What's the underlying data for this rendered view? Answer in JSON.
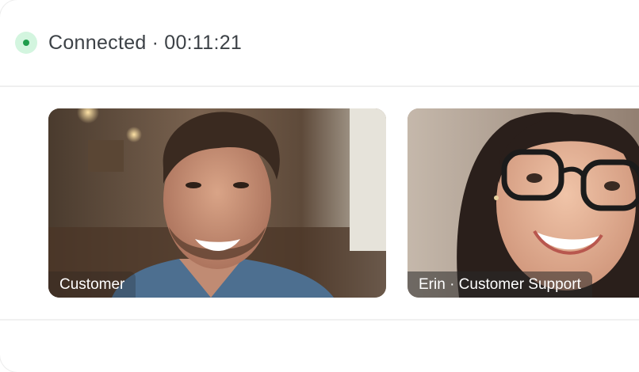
{
  "status": {
    "state": "Connected",
    "separator": "·",
    "timer": "00:11:21",
    "indicator_color": "#1f9d4c"
  },
  "participants": [
    {
      "label": "Customer"
    },
    {
      "label": "Erin · Customer Support"
    }
  ]
}
